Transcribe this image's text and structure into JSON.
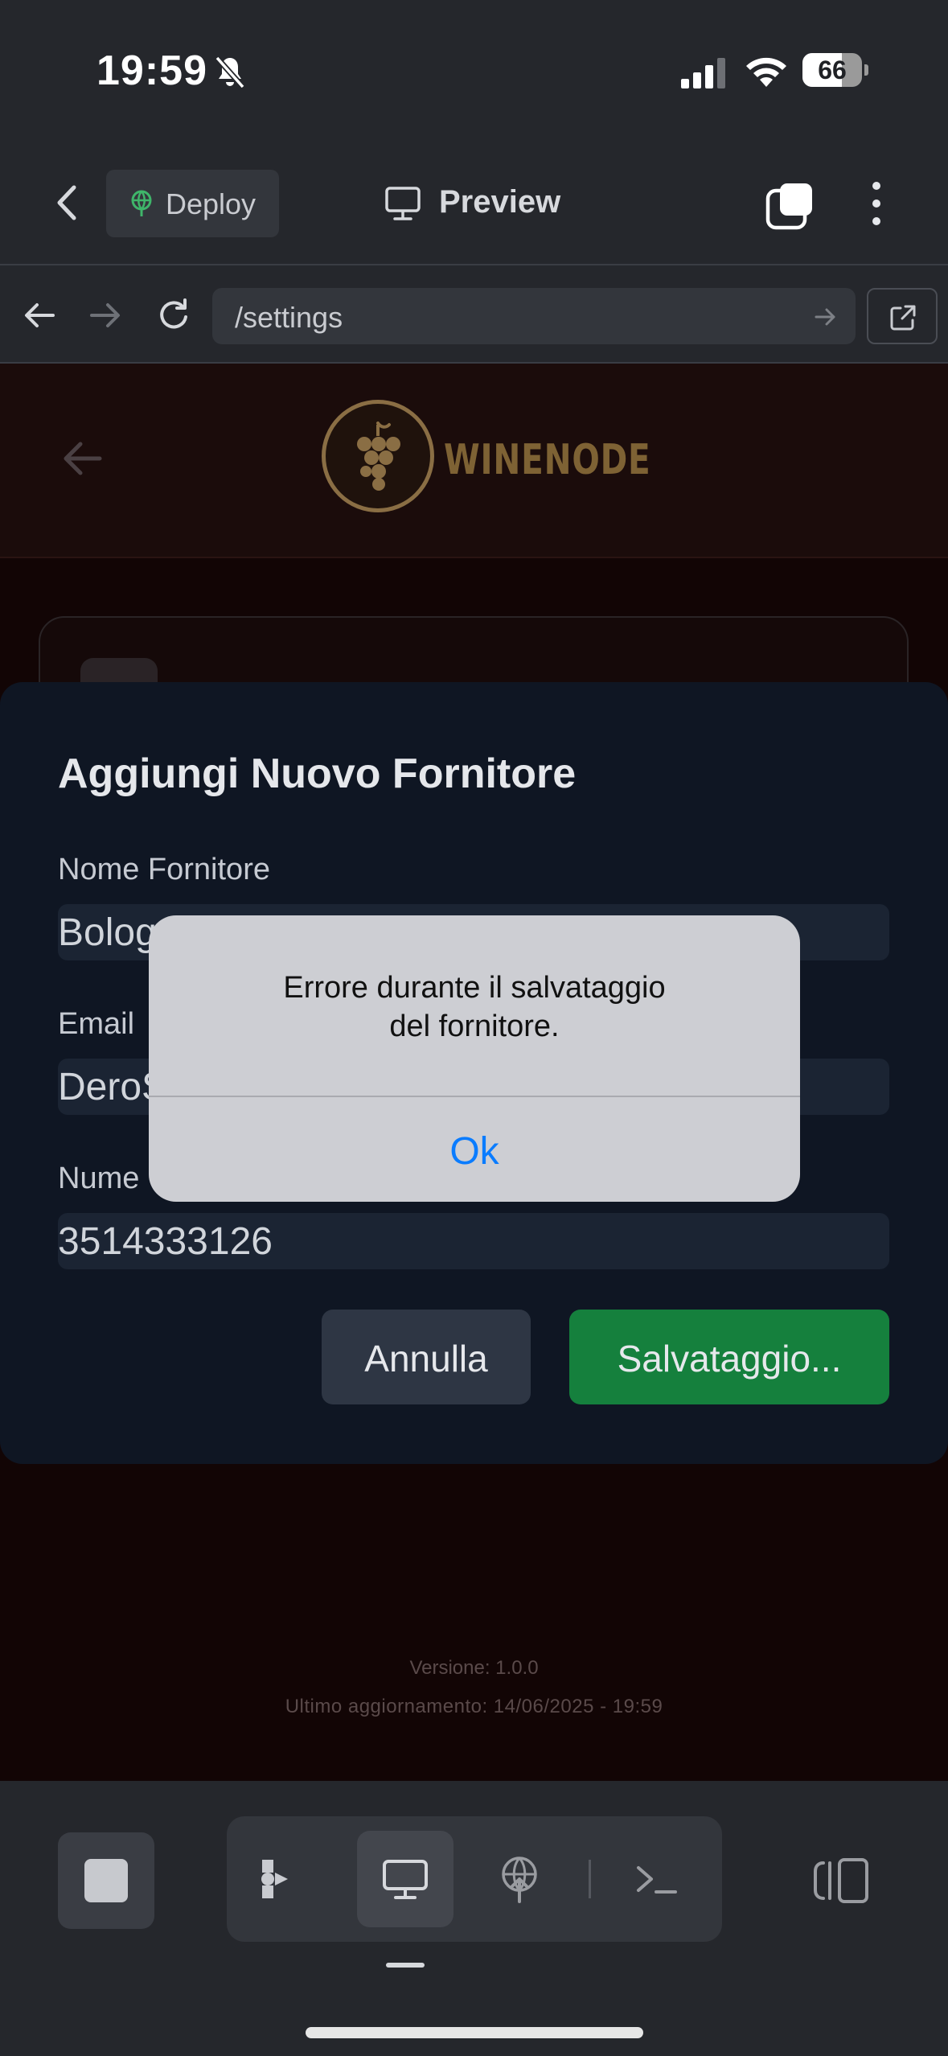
{
  "status_bar": {
    "time": "19:59",
    "battery": "66",
    "battery_level": 0.66
  },
  "top_bar": {
    "deploy_label": "Deploy",
    "preview_label": "Preview"
  },
  "url_bar": {
    "url": "/settings"
  },
  "app": {
    "brand": "WINENODE",
    "version": "Versione: 1.0.0",
    "last_update": "Ultimo aggiornamento: 14/06/2025 - 19:59"
  },
  "modal": {
    "title": "Aggiungi Nuovo Fornitore",
    "fields": [
      {
        "label": "Nome Fornitore",
        "value": "Bolog"
      },
      {
        "label": "Email",
        "value": "DeroS"
      },
      {
        "label": "Nume",
        "value": "3514333126"
      }
    ],
    "cancel_label": "Annulla",
    "save_label": "Salvataggio..."
  },
  "alert": {
    "message_line1": "Errore durante il salvataggio",
    "message_line2": "del fornitore.",
    "ok_label": "Ok"
  },
  "colors": {
    "accent_green": "#15803d",
    "ios_blue": "#0a7cff",
    "brand_gold": "#7e6234"
  }
}
